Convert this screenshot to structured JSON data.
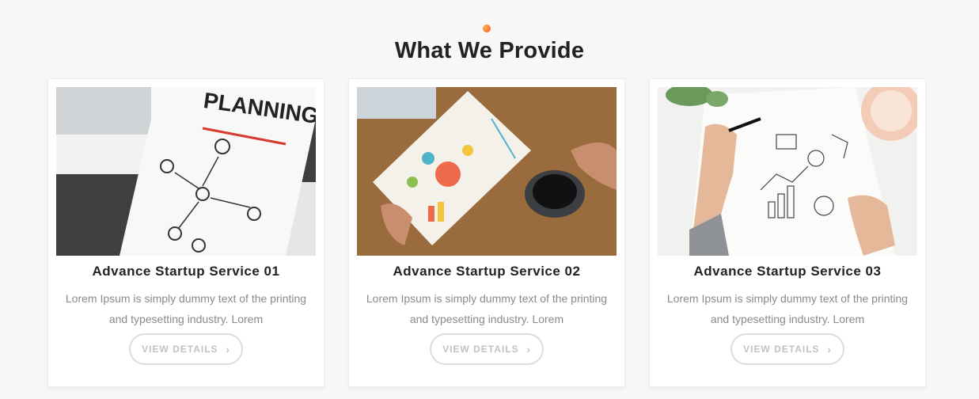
{
  "section": {
    "title": "What We Provide"
  },
  "cards": [
    {
      "title": "Advance Startup Service 01",
      "text": "Lorem Ipsum is simply dummy text of the printing and typesetting industry. Lorem",
      "button": "VIEW DETAILS",
      "image_label": "PLANNING"
    },
    {
      "title": "Advance Startup Service 02",
      "text": "Lorem Ipsum is simply dummy text of the printing and typesetting industry. Lorem",
      "button": "VIEW DETAILS"
    },
    {
      "title": "Advance Startup Service 03",
      "text": "Lorem Ipsum is simply dummy text of the printing and typesetting industry. Lorem",
      "button": "VIEW DETAILS"
    }
  ],
  "icons": {
    "button_arrow": "chevron-right-icon",
    "accent_dot": "dot-icon"
  },
  "colors": {
    "accent": "#f2542d",
    "title": "#222222",
    "body_text": "#8a8a8a",
    "button_border": "#dcdcdc"
  }
}
